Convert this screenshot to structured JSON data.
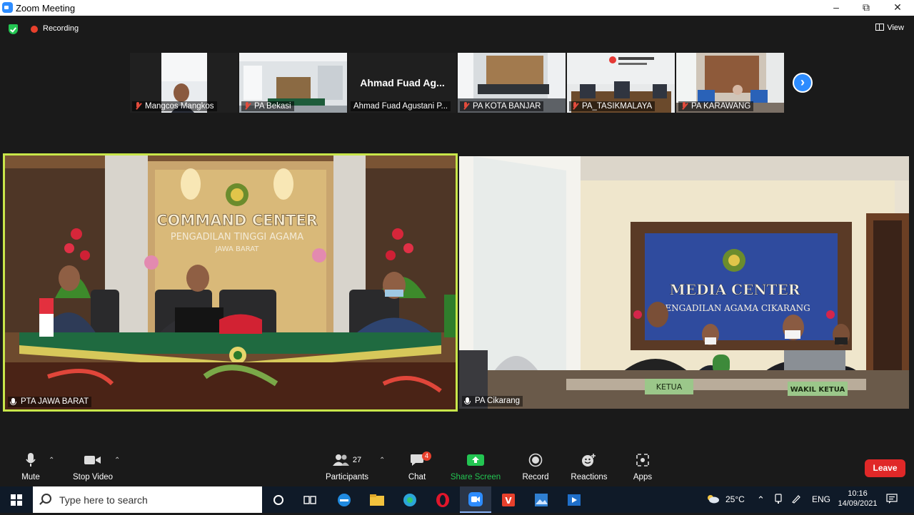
{
  "window": {
    "title": "Zoom Meeting"
  },
  "top": {
    "recording_label": "Recording",
    "view_label": "View"
  },
  "thumbnails": [
    {
      "name": "Mangcos Mangkos"
    },
    {
      "name": "PA Bekasi"
    },
    {
      "name": "Ahmad Fuad Agustani P...",
      "display_name": "Ahmad Fuad Ag..."
    },
    {
      "name": "PA KOTA BANJAR"
    },
    {
      "name": "PA_TASIKMALAYA"
    },
    {
      "name": "PA KARAWANG"
    }
  ],
  "videos": {
    "left": {
      "name": "PTA JAWA BARAT",
      "wall_title": "COMMAND CENTER",
      "wall_sub": "PENGADILAN TINGGI AGAMA",
      "wall_sub2": "JAWA BARAT"
    },
    "right": {
      "name": "PA Cikarang",
      "banner_title": "MEDIA CENTER",
      "banner_sub": "PENGADILAN AGAMA CIKARANG",
      "sign1": "KETUA",
      "sign2": "WAKIL KETUA"
    }
  },
  "toolbar": {
    "mute": "Mute",
    "stop_video": "Stop Video",
    "participants": "Participants",
    "participants_count": "27",
    "chat": "Chat",
    "chat_badge": "4",
    "share_screen": "Share Screen",
    "record": "Record",
    "reactions": "Reactions",
    "apps": "Apps",
    "leave": "Leave"
  },
  "taskbar": {
    "search_placeholder": "Type here to search",
    "temperature": "25°C",
    "language": "ENG",
    "time": "10:16",
    "date": "14/09/2021"
  },
  "colors": {
    "accent": "#2d8cff",
    "active_speaker": "#c8e64a",
    "leave": "#e02828",
    "share": "#23c552"
  }
}
